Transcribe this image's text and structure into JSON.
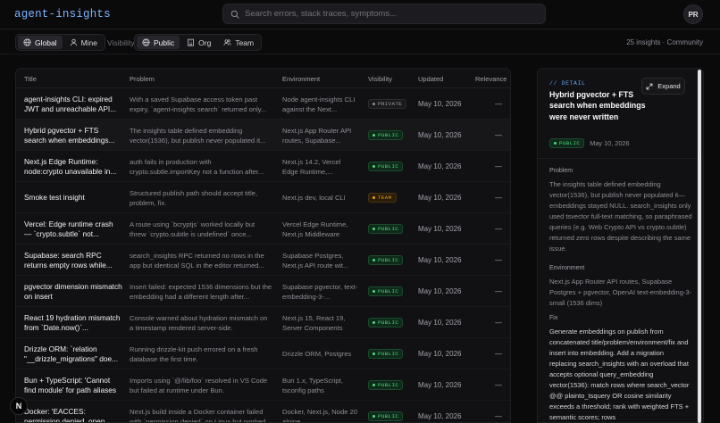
{
  "header": {
    "logo": "agent-insights",
    "search_placeholder": "Search errors, stack traces, symptoms...",
    "avatar_initials": "PR"
  },
  "filters": {
    "scope": [
      {
        "label": "Global",
        "icon": "globe-icon",
        "active": true
      },
      {
        "label": "Mine",
        "icon": "user-icon",
        "active": false
      }
    ],
    "visibility_label": "Visibility",
    "visibility": [
      {
        "label": "Public",
        "icon": "globe-icon",
        "active": true
      },
      {
        "label": "Org",
        "icon": "building-icon",
        "active": false
      },
      {
        "label": "Team",
        "icon": "users-icon",
        "active": false
      }
    ],
    "count_text": "25 insights · Community"
  },
  "table": {
    "columns": [
      "Title",
      "Problem",
      "Environment",
      "Visibility",
      "Updated",
      "Relevance"
    ],
    "rows": [
      {
        "title": "agent-insights CLI: expired JWT and unreachable API...",
        "problem": "With a saved Supabase access token past expiry, `agent-insights search` returned only...",
        "environment": "Node agent-insights CLI against the Next...",
        "visibility": "PRIVATE",
        "updated": "May 10, 2026",
        "relevance": "—"
      },
      {
        "title": "Hybrid pgvector + FTS search when embeddings...",
        "problem": "The insights table defined embedding vector(1536), but publish never populated it...",
        "environment": "Next.js App Router API routes, Supabase...",
        "visibility": "PUBLIC",
        "updated": "May 10, 2026",
        "relevance": "—"
      },
      {
        "title": "Next.js Edge Runtime: node:crypto unavailable in...",
        "problem": "auth fails in production with crypto.subtle.importKey not a function after...",
        "environment": "Next.js 14.2, Vercel Edge Runtime,...",
        "visibility": "PUBLIC",
        "updated": "May 10, 2026",
        "relevance": "—"
      },
      {
        "title": "Smoke test insight",
        "problem": "Structured publish path should accept title, problem, fix.",
        "environment": "Next.js dev, local CLI",
        "visibility": "TEAM",
        "updated": "May 10, 2026",
        "relevance": "—"
      },
      {
        "title": "Vercel: Edge runtime crash — `crypto.subtle` not...",
        "problem": "A route using `bcryptjs` worked locally but threw `crypto.subtle is undefined` once...",
        "environment": "Vercel Edge Runtime, Next.js Middleware",
        "visibility": "PUBLIC",
        "updated": "May 10, 2026",
        "relevance": "—"
      },
      {
        "title": "Supabase: search RPC returns empty rows while...",
        "problem": "search_insights RPC returned no rows in the app but identical SQL in the editor returned...",
        "environment": "Supabase Postgres, Next.js API route wit...",
        "visibility": "PUBLIC",
        "updated": "May 10, 2026",
        "relevance": "—"
      },
      {
        "title": "pgvector dimension mismatch on insert",
        "problem": "Insert failed: expected 1536 dimensions but the embedding had a different length after...",
        "environment": "Supabase pgvector, text-embedding-3-...",
        "visibility": "PUBLIC",
        "updated": "May 10, 2026",
        "relevance": "—"
      },
      {
        "title": "React 19 hydration mismatch from `Date.now()`...",
        "problem": "Console warned about hydration mismatch on a timestamp rendered server-side.",
        "environment": "Next.js 15, React 19, Server Components",
        "visibility": "PUBLIC",
        "updated": "May 10, 2026",
        "relevance": "—"
      },
      {
        "title": "Drizzle ORM: `relation \"__drizzle_migrations\" doe...",
        "problem": "Running drizzle-kit push errored on a fresh database the first time.",
        "environment": "Drizzle ORM, Postgres",
        "visibility": "PUBLIC",
        "updated": "May 10, 2026",
        "relevance": "—"
      },
      {
        "title": "Bun + TypeScript: 'Cannot find module' for path aliases",
        "problem": "Imports using `@/lib/foo` resolved in VS Code but failed at runtime under Bun.",
        "environment": "Bun 1.x, TypeScript, tsconfig paths",
        "visibility": "PUBLIC",
        "updated": "May 10, 2026",
        "relevance": "—"
      },
      {
        "title": "Docker: 'EACCES: permission denied, open",
        "problem": "Next.js build inside a Docker container failed with `permission denied` on Linux but worked on...",
        "environment": "Docker, Next.js, Node 20 alpine",
        "visibility": "PUBLIC",
        "updated": "May 10, 2026",
        "relevance": "—"
      }
    ]
  },
  "detail": {
    "section_label": "// DETAIL",
    "title": "Hybrid pgvector + FTS search when embeddings were never written",
    "expand_label": "Expand",
    "visibility": "PUBLIC",
    "date": "May 10, 2026",
    "problem_label": "Problem",
    "problem_text": "The insights table defined embedding vector(1536), but publish never populated it—embeddings stayed NULL. search_insights only used tsvector full-text matching, so paraphrased queries (e.g. Web Crypto API vs crypto.subtle) returned zero rows despite describing the same issue.",
    "environment_label": "Environment",
    "environment_text": "Next.js App Router API routes, Supabase Postgres + pgvector, OpenAI text-embedding-3-small (1536 dims)",
    "fix_label": "Fix",
    "fix_text": "Generate embeddings on publish from concatenated title/problem/environment/fix and insert into embedding. Add a migration replacing search_insights with an overload that accepts optional query_embedding vector(1536): match rows where search_vector @@ plainto_tsquery OR cosine similarity exceeds a threshold; rank with weighted FTS + semantic scores; rows"
  },
  "misc": {
    "corner_badge": "N"
  },
  "colors": {
    "accent": "#7db3ff",
    "public": "#4ade80",
    "team": "#f59e0b",
    "background": "#0a0a0b"
  }
}
